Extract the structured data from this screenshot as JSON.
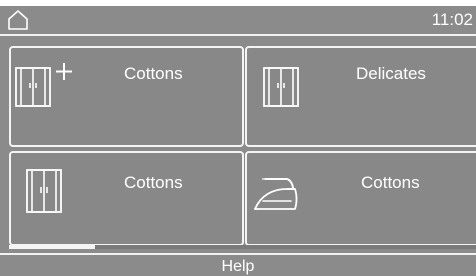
{
  "status_bar": {
    "home_icon": "home-icon",
    "time": "11:02"
  },
  "programs": [
    {
      "label": "Cottons",
      "icon": "wardrobe-plus-icon"
    },
    {
      "label": "Delicates",
      "icon": "wardrobe-icon"
    },
    {
      "label": "Cottons",
      "icon": "wardrobe-icon"
    },
    {
      "label": "Cottons",
      "icon": "iron-icon"
    }
  ],
  "pagination": {
    "position": 0.18
  },
  "footer": {
    "help_label": "Help"
  },
  "colors": {
    "background": "#8b8b8b",
    "foreground": "#ffffff"
  }
}
